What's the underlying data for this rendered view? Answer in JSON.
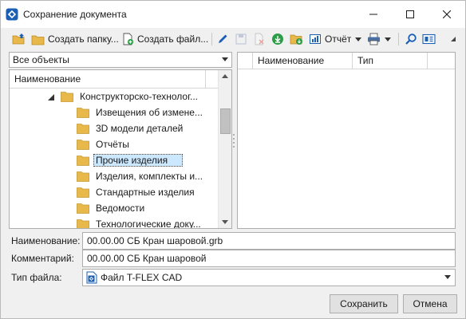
{
  "window": {
    "title": "Сохранение документа"
  },
  "toolbar": {
    "create_folder": "Создать папку...",
    "create_file": "Создать файл...",
    "report": "Отчёт"
  },
  "filter": {
    "value": "Все объекты"
  },
  "tree": {
    "header": "Наименование",
    "parent": "Конструкторско-технолог...",
    "items": [
      "Извещения об измене...",
      "3D модели деталей",
      "Отчёты",
      "Прочие изделия",
      "Изделия, комплекты и...",
      "Стандартные изделия",
      "Ведомости",
      "Технологические доку..."
    ],
    "selected_index": 3
  },
  "list": {
    "col_name": "Наименование",
    "col_type": "Тип"
  },
  "form": {
    "name_label": "Наименование:",
    "name_value": "00.00.00 СБ Кран шаровой.grb",
    "comment_label": "Комментарий:",
    "comment_value": "00.00.00 СБ Кран шаровой",
    "filetype_label": "Тип файла:",
    "filetype_value": "Файл T-FLEX CAD"
  },
  "buttons": {
    "save": "Сохранить",
    "cancel": "Отмена"
  },
  "colors": {
    "accent": "#1a5fb4",
    "folder": "#e8b84a",
    "selection": "#cce8ff",
    "green": "#2e9b48"
  }
}
